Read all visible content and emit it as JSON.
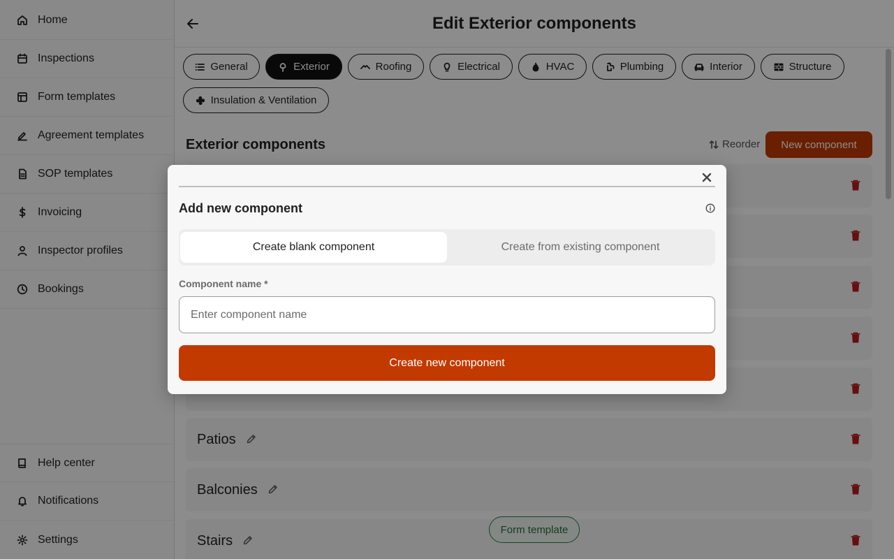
{
  "sidebar": {
    "items": [
      {
        "label": "Home",
        "icon": "home-icon"
      },
      {
        "label": "Inspections",
        "icon": "calendar-icon"
      },
      {
        "label": "Form templates",
        "icon": "layout-icon"
      },
      {
        "label": "Agreement templates",
        "icon": "signature-icon"
      },
      {
        "label": "SOP templates",
        "icon": "document-icon"
      },
      {
        "label": "Invoicing",
        "icon": "dollar-icon"
      },
      {
        "label": "Inspector profiles",
        "icon": "user-icon"
      },
      {
        "label": "Bookings",
        "icon": "clock-icon"
      }
    ],
    "bottom_items": [
      {
        "label": "Help center",
        "icon": "book-icon"
      },
      {
        "label": "Notifications",
        "icon": "bell-icon"
      },
      {
        "label": "Settings",
        "icon": "gear-icon"
      }
    ]
  },
  "header": {
    "title": "Edit Exterior components"
  },
  "tabs": [
    {
      "label": "General",
      "icon": "list-icon",
      "active": false
    },
    {
      "label": "Exterior",
      "icon": "tree-icon",
      "active": true
    },
    {
      "label": "Roofing",
      "icon": "roof-icon",
      "active": false
    },
    {
      "label": "Electrical",
      "icon": "bulb-icon",
      "active": false
    },
    {
      "label": "HVAC",
      "icon": "flame-icon",
      "active": false
    },
    {
      "label": "Plumbing",
      "icon": "faucet-icon",
      "active": false
    },
    {
      "label": "Interior",
      "icon": "sofa-icon",
      "active": false
    },
    {
      "label": "Structure",
      "icon": "bricks-icon",
      "active": false
    },
    {
      "label": "Insulation & Ventilation",
      "icon": "fan-icon",
      "active": false
    }
  ],
  "section": {
    "title": "Exterior components",
    "reorder_label": "Reorder",
    "new_component_label": "New component"
  },
  "components": [
    {
      "label": ""
    },
    {
      "label": ""
    },
    {
      "label": ""
    },
    {
      "label": ""
    },
    {
      "label": ""
    },
    {
      "label": "Patios"
    },
    {
      "label": "Balconies"
    },
    {
      "label": "Stairs"
    }
  ],
  "floating": {
    "form_template_label": "Form template"
  },
  "modal": {
    "title": "Add new component",
    "segments": {
      "blank": "Create blank component",
      "existing": "Create from existing component"
    },
    "field_label": "Component name *",
    "field_placeholder": "Enter component name",
    "field_value": "",
    "submit_label": "Create new component"
  },
  "colors": {
    "accent": "#c23a00",
    "chip_active": "#111111",
    "delete": "#b91c1c",
    "form_template": "#2f7d4a"
  }
}
